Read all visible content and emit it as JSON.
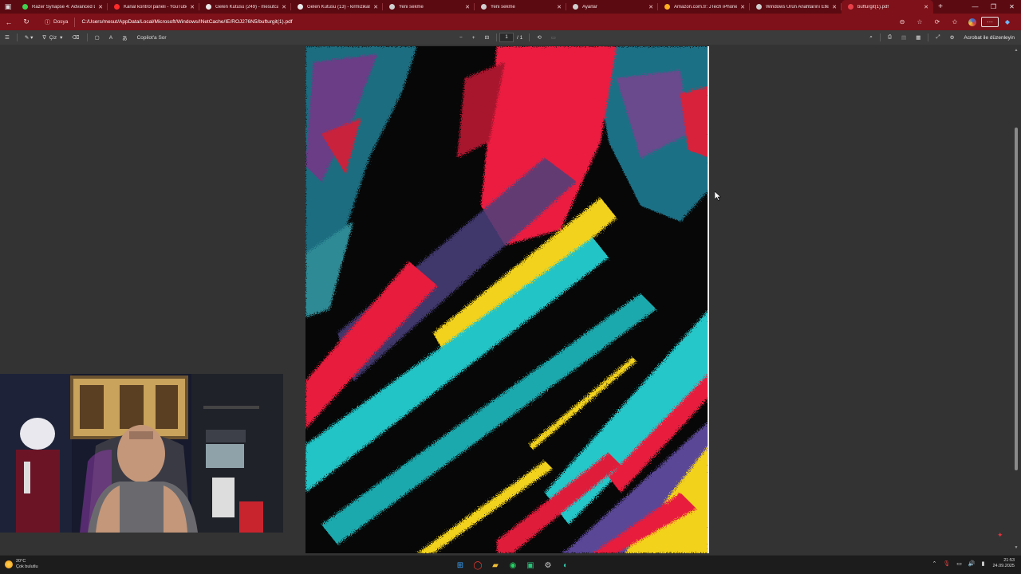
{
  "tabs": [
    {
      "title": "Razer Synapse 4: Advanced De",
      "color": "#3fd34f",
      "active": false
    },
    {
      "title": "Kanal kontrol paneli - YouTube",
      "color": "#ff2a2a",
      "active": false
    },
    {
      "title": "Gelen Kutusu (249) - mesutcan",
      "color": "#e8e8e8",
      "active": false
    },
    {
      "title": "Gelen Kutusu (13) - kirmizikalat",
      "color": "#e8e8e8",
      "active": false
    },
    {
      "title": "Yeni sekme",
      "color": "#cfcfcf",
      "active": false
    },
    {
      "title": "Yeni sekme",
      "color": "#cfcfcf",
      "active": false
    },
    {
      "title": "Ayarlar",
      "color": "#cfcfcf",
      "active": false
    },
    {
      "title": "Amazon.com.tr: JTech iPhone",
      "color": "#ffb020",
      "active": false
    },
    {
      "title": "Windows Ürün Anahtarını Etkin",
      "color": "#cfcfcf",
      "active": false
    },
    {
      "title": "bufturgit(1).pdf",
      "color": "#e8404a",
      "active": true
    }
  ],
  "address": {
    "chip_label": "Dosya",
    "url": "C:/Users/mesut/AppData/Local/Microsoft/Windows/INetCache/IE/ROJ276N5/bufturgit(1).pdf"
  },
  "pdf_toolbar": {
    "draw_label": "Çiz",
    "copilot_label": "Copilot'a Sor",
    "page_current": "1",
    "page_total": "/ 1",
    "acrobat_label": "Acrobat ile düzenleyin"
  },
  "taskbar": {
    "temp": "20°C",
    "weather": "Çok bulutlu",
    "time": "21:53",
    "date": "24.09.2025"
  },
  "colors": {
    "tabbar": "#5c0a12",
    "addressbar": "#7e1119",
    "viewer": "#333333",
    "pdf_toolbar": "#3b3b3b"
  }
}
